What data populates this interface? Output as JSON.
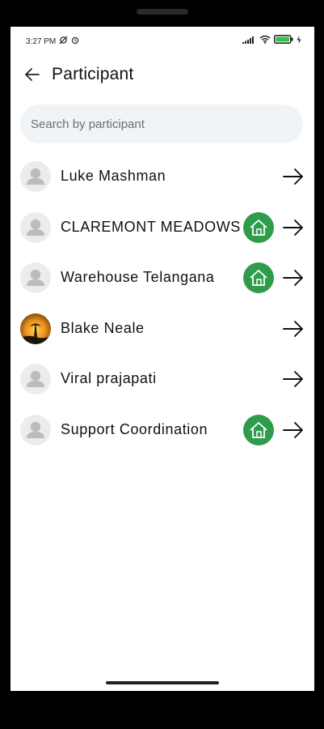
{
  "status_bar": {
    "time": "3:27 PM",
    "icons": [
      "no-sync-icon",
      "alarm-icon",
      "signal-icon",
      "wifi-icon",
      "battery-icon",
      "charging-icon"
    ]
  },
  "header": {
    "back_icon": "arrow-left-icon",
    "title": "Participant"
  },
  "search": {
    "placeholder": "Search by participant",
    "value": ""
  },
  "participants": [
    {
      "name": "Luke Mashman",
      "avatar": "default-avatar",
      "has_home_badge": false
    },
    {
      "name": "CLAREMONT MEADOWS",
      "avatar": "default-avatar",
      "has_home_badge": true
    },
    {
      "name": "Warehouse Telangana",
      "avatar": "default-avatar",
      "has_home_badge": true
    },
    {
      "name": "Blake Neale",
      "avatar": "photo-avatar",
      "has_home_badge": false
    },
    {
      "name": "Viral prajapati",
      "avatar": "default-avatar",
      "has_home_badge": false
    },
    {
      "name": "Support Coordination",
      "avatar": "default-avatar",
      "has_home_badge": true
    }
  ],
  "colors": {
    "badge_green": "#2e9c4b",
    "search_bg": "#f0f4f7",
    "battery_green": "#35c24a"
  }
}
